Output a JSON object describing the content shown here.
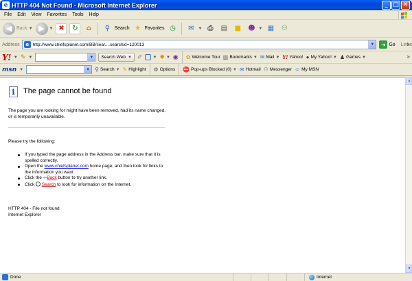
{
  "window": {
    "title": "HTTP 404 Not Found - Microsoft Internet Explorer"
  },
  "menu": [
    "File",
    "Edit",
    "View",
    "Favorites",
    "Tools",
    "Help"
  ],
  "toolbar": {
    "back": "Back",
    "search": "Search",
    "favorites": "Favorites"
  },
  "address": {
    "label": "Address",
    "url": "http://www.chiefsplanet.com/BB/sear....searchid=120013",
    "go": "Go",
    "links": "Links"
  },
  "yahoo": {
    "logo": "Y!",
    "search_web": "Search Web",
    "welcome_tour": "Welcome Tour",
    "bookmarks": "Bookmarks",
    "mail": "Mail",
    "yahoo": "Yahoo!",
    "my_yahoo": "My Yahoo!",
    "games": "Games"
  },
  "msn": {
    "logo": "msn",
    "search": "Search",
    "highlight": "Highlight",
    "options": "Options",
    "popups": "Pop-ups Blocked (0)",
    "hotmail": "Hotmail",
    "messenger": "Messenger",
    "my_msn": "My MSN"
  },
  "page": {
    "heading": "The page cannot be found",
    "intro": "The page you are looking for might have been removed, had its name changed, or is temporarily unavailable.",
    "try": "Please try the following:",
    "bullet1": "If you typed the page address in the Address bar, make sure that it is spelled correctly.",
    "bullet2_pre": "Open the ",
    "bullet2_link": "www.chiefsplanet.com",
    "bullet2_post": " home page, and then look for links to the information you want.",
    "bullet3_pre": "Click the ",
    "bullet3_link": "Back",
    "bullet3_post": " button to try another link.",
    "bullet4_pre": "Click ",
    "bullet4_link": "Search",
    "bullet4_post": " to look for information on the Internet.",
    "error_code": "HTTP 404 - File not found",
    "error_source": "Internet Explorer"
  },
  "status": {
    "text": "Done",
    "zone": "Internet"
  }
}
